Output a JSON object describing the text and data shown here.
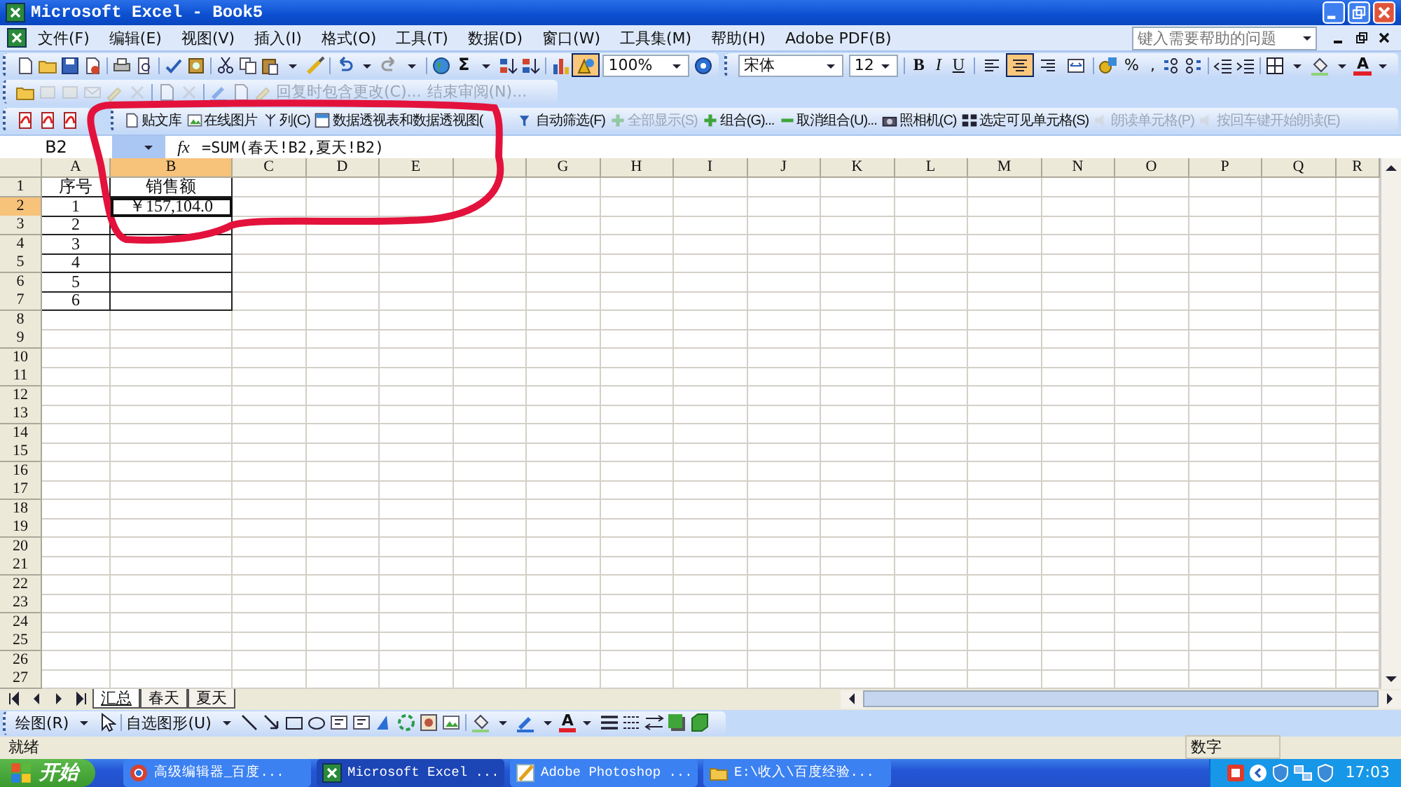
{
  "window": {
    "title": "Microsoft Excel - Book5"
  },
  "menu_bar": {
    "items": [
      "文件(F)",
      "编辑(E)",
      "视图(V)",
      "插入(I)",
      "格式(O)",
      "工具(T)",
      "数据(D)",
      "窗口(W)",
      "工具集(M)",
      "帮助(H)",
      "Adobe PDF(B)"
    ],
    "help_search": {
      "placeholder": "键入需要帮助的问题"
    }
  },
  "standard_toolbar": {
    "autosum": "Σ",
    "zoom": "100%",
    "drawing_toggle": {
      "selected": true
    }
  },
  "formatting_toolbar": {
    "font": "宋体",
    "size": "12",
    "style_buttons": [
      "B",
      "I",
      "U"
    ],
    "align_buttons": [
      {
        "selected": false
      },
      {
        "selected": true
      },
      {
        "selected": false
      },
      {
        "selected": false
      }
    ],
    "percent": "%",
    "comma": ",",
    "font_color_letter": "A"
  },
  "reviewing_toolbar": {
    "items": [
      {
        "label": "回复时包含更改(C)...",
        "disabled": true
      },
      {
        "label": "结束审阅(N)...",
        "disabled": true
      }
    ]
  },
  "tools_toolbar": {
    "items": [
      {
        "label": "贴文库",
        "disabled": false
      },
      {
        "label": "在线图片",
        "disabled": false
      },
      {
        "label": "列(C)",
        "disabled": false
      },
      {
        "label": "数据透视表和数据透视图(",
        "disabled": false
      },
      {
        "label": "自动筛选(F)",
        "disabled": false
      },
      {
        "label": "全部显示(S)",
        "disabled": true
      },
      {
        "label": "组合(G)...",
        "disabled": false
      },
      {
        "label": "取消组合(U)...",
        "disabled": false
      },
      {
        "label": "照相机(C)",
        "disabled": false
      },
      {
        "label": "选定可见单元格(S)",
        "disabled": false
      },
      {
        "label": "朗读单元格(P)",
        "disabled": true
      },
      {
        "label": "按回车键开始朗读(E)",
        "disabled": true
      }
    ]
  },
  "formula_bar": {
    "name_box": "B2",
    "fx": "fx",
    "formula": "=SUM(春天!B2,夏天!B2)"
  },
  "sheet": {
    "columns": [
      {
        "label": "A",
        "selected": false
      },
      {
        "label": "B",
        "selected": true
      },
      {
        "label": "C",
        "selected": false
      },
      {
        "label": "D",
        "selected": false
      },
      {
        "label": "E",
        "selected": false
      },
      {
        "selected": false
      },
      {
        "label": "G",
        "selected": false
      },
      {
        "label": "H",
        "selected": false
      },
      {
        "label": "I",
        "selected": false
      },
      {
        "label": "J",
        "selected": false
      },
      {
        "label": "K",
        "selected": false
      },
      {
        "label": "L",
        "selected": false
      },
      {
        "label": "M",
        "selected": false
      },
      {
        "label": "N",
        "selected": false
      },
      {
        "label": "O",
        "selected": false
      },
      {
        "label": "P",
        "selected": false
      },
      {
        "label": "Q",
        "selected": false
      },
      {
        "label": "R",
        "selected": false
      }
    ],
    "rows": [
      {
        "label": "1",
        "selected": false,
        "cells": [
          {
            "text": "序号",
            "selected": false
          },
          {
            "text": "销售额",
            "selected": false
          }
        ]
      },
      {
        "label": "2",
        "selected": true,
        "cells": [
          {
            "text": "1",
            "selected": false
          },
          {
            "text": "￥157,104.0",
            "selected": true
          }
        ]
      },
      {
        "label": "3",
        "selected": false,
        "cells": [
          {
            "text": "2",
            "selected": false
          },
          {
            "selected": false
          }
        ]
      },
      {
        "label": "4",
        "selected": false,
        "cells": [
          {
            "text": "3",
            "selected": false
          },
          {
            "selected": false
          }
        ]
      },
      {
        "label": "5",
        "selected": false,
        "cells": [
          {
            "text": "4",
            "selected": false
          },
          {
            "selected": false
          }
        ]
      },
      {
        "label": "6",
        "selected": false,
        "cells": [
          {
            "text": "5",
            "selected": false
          },
          {
            "selected": false
          }
        ]
      },
      {
        "label": "7",
        "selected": false,
        "cells": [
          {
            "text": "6",
            "selected": false
          },
          {
            "selected": false
          }
        ]
      },
      {
        "label": "8",
        "selected": false
      },
      {
        "label": "9",
        "selected": false
      },
      {
        "label": "10",
        "selected": false
      },
      {
        "label": "11",
        "selected": false
      },
      {
        "label": "12",
        "selected": false
      },
      {
        "label": "13",
        "selected": false
      },
      {
        "label": "14",
        "selected": false
      },
      {
        "label": "15",
        "selected": false
      },
      {
        "label": "16",
        "selected": false
      },
      {
        "label": "17",
        "selected": false
      },
      {
        "label": "18",
        "selected": false
      },
      {
        "label": "19",
        "selected": false
      },
      {
        "label": "20",
        "selected": false
      },
      {
        "label": "21",
        "selected": false
      },
      {
        "label": "22",
        "selected": false
      },
      {
        "label": "23",
        "selected": false
      },
      {
        "label": "24",
        "selected": false
      },
      {
        "label": "25",
        "selected": false
      },
      {
        "label": "26",
        "selected": false
      },
      {
        "label": "27",
        "selected": false
      }
    ]
  },
  "sheet_tabs": [
    {
      "label": "汇总",
      "selected": true
    },
    {
      "label": "春天",
      "selected": false
    },
    {
      "label": "夏天",
      "selected": false
    }
  ],
  "drawing_toolbar": {
    "draw_menu": "绘图(R)",
    "autoshapes": "自选图形(U)",
    "font_color_letter": "A"
  },
  "status_bar": {
    "status": "就绪",
    "mode": "数字"
  },
  "taskbar": {
    "start": "开始",
    "tasks": [
      {
        "label": "高级编辑器_百度...",
        "selected": false
      },
      {
        "label": "Microsoft Excel ...",
        "selected": true
      },
      {
        "label": "Adobe Photoshop ...",
        "selected": false
      },
      {
        "label": "E:\\收入\\百度经验...",
        "selected": false
      }
    ],
    "clock": "17:03"
  }
}
